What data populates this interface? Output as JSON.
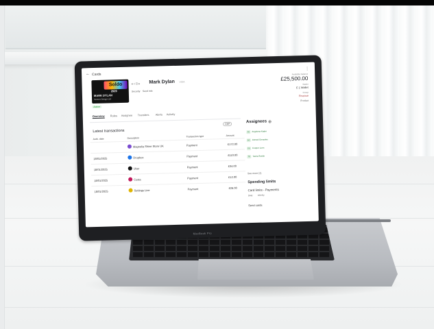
{
  "app": {
    "breadcrumb": "Cards",
    "card_holder": "Mark Dylan",
    "card_holder_tag": "VISA",
    "card": {
      "brand": "Soldo",
      "name": "MARK DYLAN",
      "company": "Screen Design Ltd",
      "last_digits": "2929"
    },
    "card_actions": [
      "Security",
      "Send info"
    ],
    "status": "Active",
    "balance_label": "Available balance",
    "balance": "£25,500.00",
    "meta": [
      {
        "label": "Wallet",
        "value": "£ 1 Wallet"
      },
      {
        "label": "Group",
        "value": "Finance"
      },
      {
        "label": "",
        "value": "Product"
      }
    ],
    "tabs": [
      "Overview",
      "Rules",
      "Assignee",
      "Transfers",
      "Alerts",
      "Activity"
    ],
    "active_tab": "Overview",
    "transactions": {
      "title": "Latest transactions",
      "currency_filter": "GBP",
      "columns": [
        "Auth. date",
        "Description",
        "Transaction type",
        "Amount"
      ],
      "rows": [
        {
          "date": "",
          "merchant": "Magnolia Shine Store UK",
          "type": "Payment",
          "amount": "£172.00",
          "icon_color": "#7a4bd0"
        },
        {
          "date": "18/01/2025",
          "merchant": "Dropbox",
          "type": "Payment",
          "amount": "£110.00",
          "icon_color": "#1a73e8"
        },
        {
          "date": "18/01/2025",
          "merchant": "Uber",
          "type": "Payment",
          "amount": "£34.00",
          "icon_color": "#111111"
        },
        {
          "date": "18/01/2025",
          "merchant": "Costa",
          "type": "Payment",
          "amount": "£12.00",
          "icon_color": "#c2185b"
        },
        {
          "date": "18/01/2025",
          "merchant": "Settings Live",
          "type": "Payment",
          "amount": "£26.00",
          "icon_color": "#e0b400"
        }
      ]
    },
    "assignees": {
      "title": "Assignees",
      "add_icon": "plus-circle-icon",
      "items": [
        {
          "initials": "AS",
          "name": "Angelena Kader"
        },
        {
          "initials": "AG",
          "name": "Ahmed Gonzales"
        },
        {
          "initials": "CS",
          "name": "Cooper Lunn"
        },
        {
          "initials": "TD",
          "name": "Tasha Rowlin"
        }
      ],
      "see_more": "See more (2)"
    },
    "spending": {
      "title": "Spending limits",
      "card_limits": "Card limits - Payments",
      "tags": [
        "Daily",
        "Weekly"
      ],
      "send_cards": "Send cards"
    }
  },
  "device": {
    "label": "MacBook Pro"
  }
}
